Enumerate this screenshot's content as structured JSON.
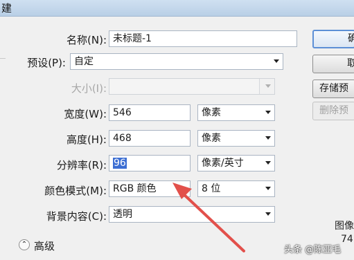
{
  "window": {
    "title_fragment": "建"
  },
  "form": {
    "name": {
      "label": "名称(N):",
      "value": "未标题-1"
    },
    "preset": {
      "label": "预设(P):",
      "value": "自定"
    },
    "size": {
      "label": "大小(I):",
      "value": ""
    },
    "width": {
      "label": "宽度(W):",
      "value": "546",
      "unit": "像素"
    },
    "height": {
      "label": "高度(H):",
      "value": "468",
      "unit": "像素"
    },
    "resolution": {
      "label": "分辨率(R):",
      "value": "96",
      "unit": "像素/英寸"
    },
    "color_mode": {
      "label": "颜色模式(M):",
      "value": "RGB 颜色",
      "depth": "8 位"
    },
    "background": {
      "label": "背景内容(C):",
      "value": "透明"
    },
    "advanced": {
      "label": "高级",
      "toggle": "⌃"
    }
  },
  "buttons": {
    "ok": "确",
    "cancel": "取",
    "save_preset": "存储预",
    "delete_preset": "删除预"
  },
  "side": {
    "image_size_label": "图像",
    "image_size_value": "74"
  },
  "watermark": "头条 @陈亚毛",
  "colors": {
    "selection": "#3c6ed3",
    "arrow": "#e2504b"
  }
}
